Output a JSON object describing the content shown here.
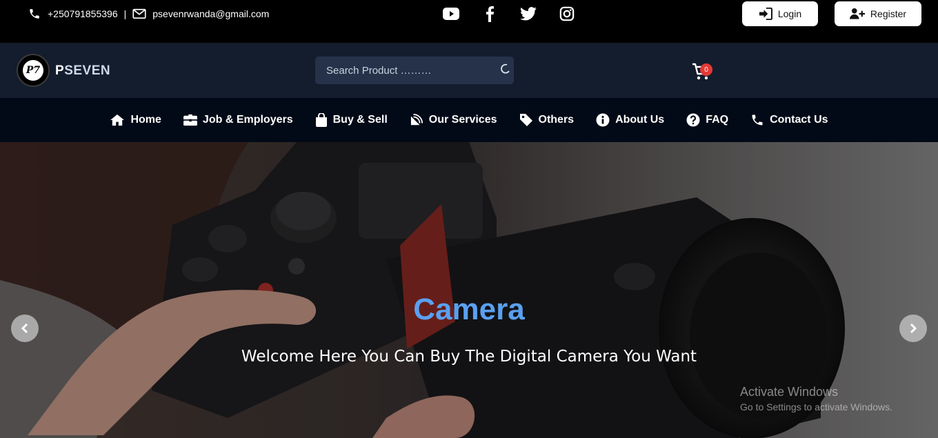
{
  "topbar": {
    "phone": "+250791855396",
    "separator": "|",
    "email": "psevenrwanda@gmail.com",
    "social": [
      "youtube-icon",
      "facebook-icon",
      "twitter-icon",
      "instagram-icon"
    ],
    "login_label": "Login",
    "register_label": "Register"
  },
  "header": {
    "logo_text": "P7",
    "brand_first": "P",
    "brand_rest": "SEVEN",
    "search_placeholder": "Search Product ………",
    "cart_count": "0"
  },
  "nav": {
    "items": [
      {
        "label": "Home",
        "icon": "home-icon"
      },
      {
        "label": "Job & Employers",
        "icon": "briefcase-icon"
      },
      {
        "label": "Buy & Sell",
        "icon": "shopping-bag-icon"
      },
      {
        "label": "Our Services",
        "icon": "satellite-dish-icon"
      },
      {
        "label": "Others",
        "icon": "tag-icon"
      },
      {
        "label": "About Us",
        "icon": "info-icon"
      },
      {
        "label": "FAQ",
        "icon": "question-icon"
      },
      {
        "label": "Contact Us",
        "icon": "phone-icon"
      }
    ]
  },
  "hero": {
    "title": "Camera",
    "subtitle": "Welcome Here You Can Buy The Digital Camera You Want",
    "title_color": "#5aa0f0"
  },
  "watermark": {
    "line1": "Activate Windows",
    "line2": "Go to Settings to activate Windows."
  },
  "colors": {
    "topbar_bg": "#000000",
    "header_bg": "#141d2d",
    "nav_bg": "#030a17",
    "badge": "#e53935"
  }
}
